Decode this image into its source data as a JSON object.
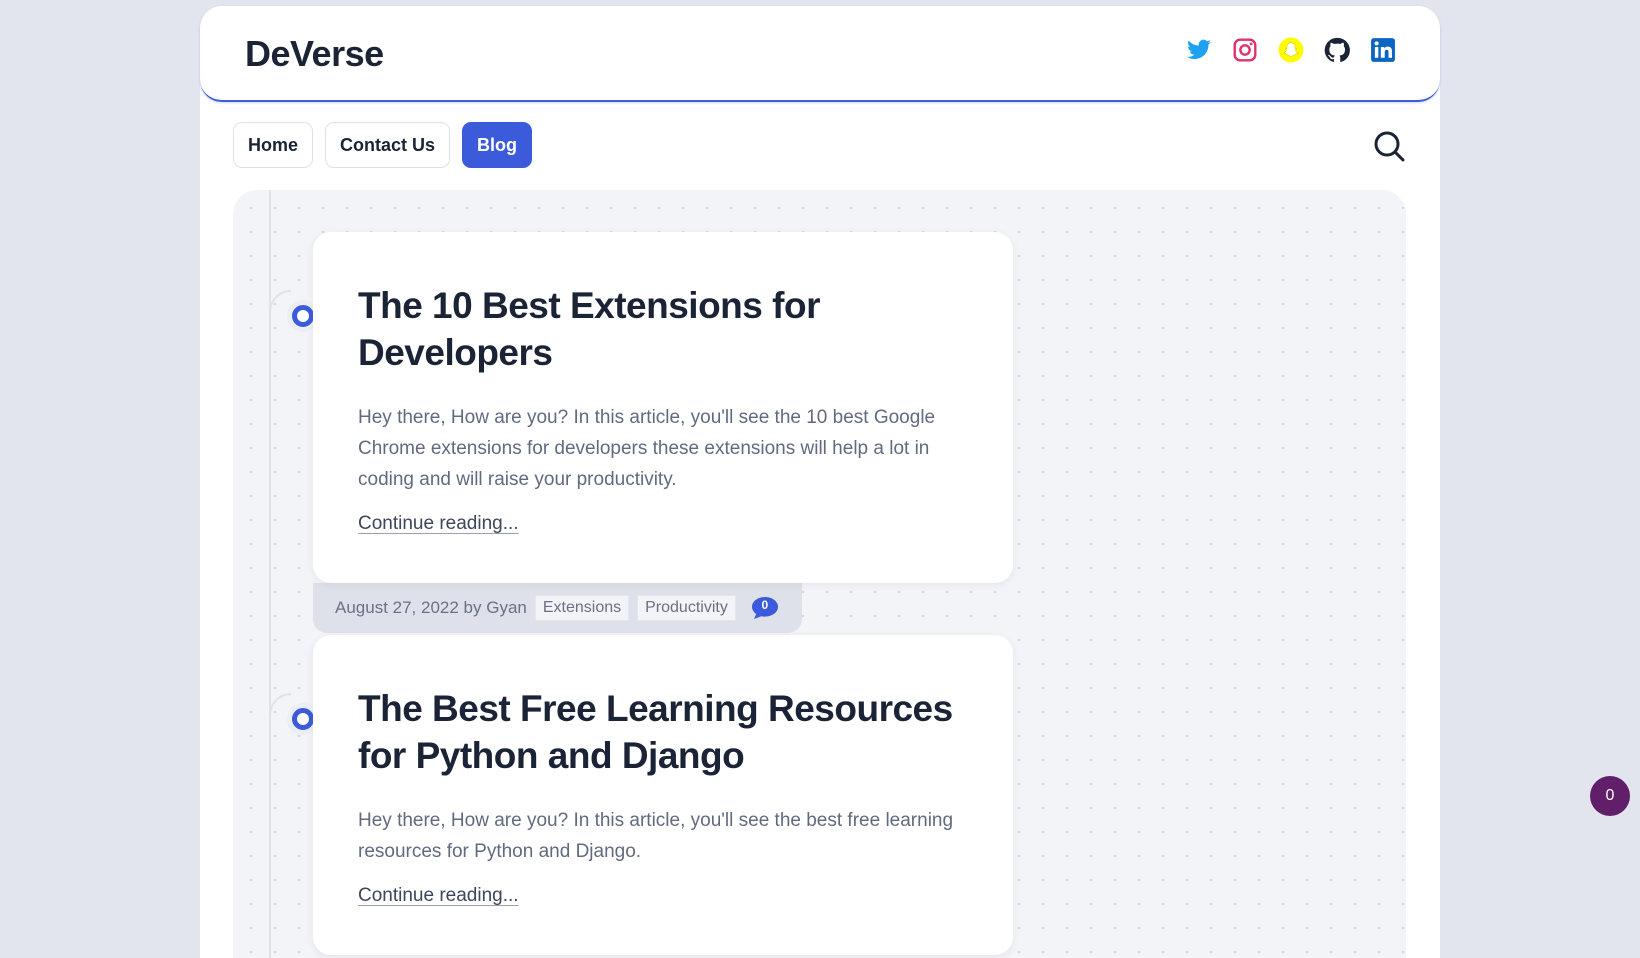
{
  "site": {
    "logo": "DeVerse"
  },
  "social": [
    {
      "name": "twitter-icon",
      "color": "#1da1f2"
    },
    {
      "name": "instagram-icon",
      "color": "#e1306c"
    },
    {
      "name": "snapchat-icon",
      "color": "#fffc00"
    },
    {
      "name": "github-icon",
      "color": "#1b2336"
    },
    {
      "name": "linkedin-icon",
      "color": "#0a66c2"
    }
  ],
  "nav": {
    "home": "Home",
    "contact": "Contact Us",
    "blog": "Blog",
    "active": "Blog"
  },
  "posts": [
    {
      "title": "The 10 Best Extensions for Developers",
      "excerpt": "Hey there, How are you? In this article, you'll see the 10 best Google Chrome extensions for developers these extensions will help a lot in coding and will raise your productivity.",
      "more": "Continue reading...",
      "meta": "August 27, 2022 by Gyan",
      "tags": [
        "Extensions",
        "Productivity"
      ],
      "comments": "0"
    },
    {
      "title": "The Best Free Learning Resources for Python and Django",
      "excerpt": "Hey there, How are you? In this article, you'll see the best free learning resources for Python and Django.",
      "more": "Continue reading..."
    }
  ],
  "floating_counter": "0",
  "colors": {
    "accent": "#3b5bdb",
    "fab": "#611f69",
    "text": "#1b2336"
  }
}
